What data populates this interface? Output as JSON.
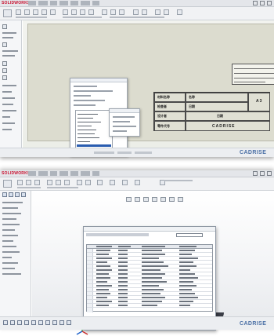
{
  "screenshots": [
    {
      "app": {
        "logo": "SOLIDWORKS"
      },
      "title_block": {
        "row1_left": "材料名称",
        "row1_right": "名称",
        "row2_left": "检查者",
        "row2_right": "日期",
        "row3_left": "设计者",
        "row3_right": "日期",
        "row4_left": "零件代号",
        "brand_text": "CADRISE",
        "size_text": "A3"
      },
      "brand": "CADRISE"
    },
    {
      "app": {
        "logo": "SOLIDWORKS"
      },
      "brand": "CADRISE"
    }
  ],
  "colors": {
    "accent": "#2a5db0",
    "brand": "#4a6fa5",
    "logo": "#c8102e"
  }
}
